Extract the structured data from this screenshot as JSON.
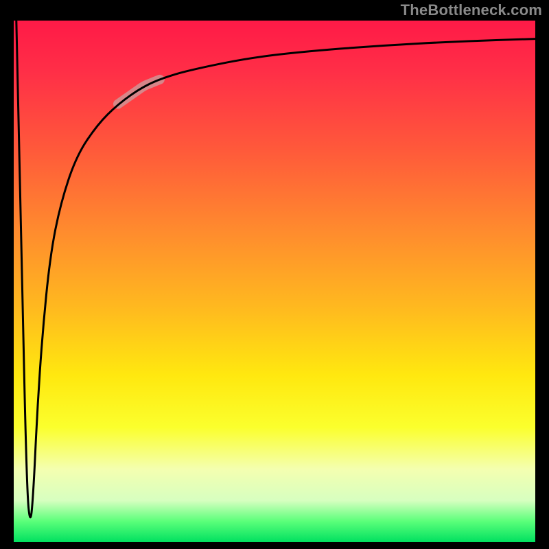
{
  "attribution": "TheBottleneck.com",
  "chart_data": {
    "type": "line",
    "title": "",
    "xlabel": "",
    "ylabel": "",
    "xlim": [
      0,
      100
    ],
    "ylim": [
      0,
      100
    ],
    "grid": false,
    "legend": false,
    "annotations": [],
    "background_gradient_stops": [
      {
        "pos": 0,
        "color": "#ff1a47"
      },
      {
        "pos": 10,
        "color": "#ff2f47"
      },
      {
        "pos": 25,
        "color": "#ff5a3a"
      },
      {
        "pos": 40,
        "color": "#ff8a2e"
      },
      {
        "pos": 55,
        "color": "#ffb91f"
      },
      {
        "pos": 68,
        "color": "#ffe80f"
      },
      {
        "pos": 78,
        "color": "#fbff2d"
      },
      {
        "pos": 86,
        "color": "#f4ffb0"
      },
      {
        "pos": 92,
        "color": "#d7ffc0"
      },
      {
        "pos": 96,
        "color": "#5bff7a"
      },
      {
        "pos": 100,
        "color": "#00e060"
      }
    ],
    "series": [
      {
        "name": "bottleneck-curve",
        "color": "#000000",
        "stroke_width": 3,
        "x": [
          0.5,
          1.5,
          2.5,
          3.2,
          3.8,
          4.5,
          5.5,
          7,
          9,
          12,
          16,
          20,
          25,
          30,
          36,
          45,
          55,
          70,
          85,
          100
        ],
        "y": [
          100,
          55,
          10,
          3,
          10,
          25,
          40,
          55,
          65,
          74,
          80,
          84,
          87.5,
          89.5,
          91,
          92.8,
          94,
          95.2,
          96,
          96.5
        ]
      }
    ],
    "highlight_segment": {
      "series": "bottleneck-curve",
      "x_range": [
        20,
        28
      ],
      "color": "#caa0a0",
      "stroke_width": 14,
      "opacity": 0.75
    }
  }
}
